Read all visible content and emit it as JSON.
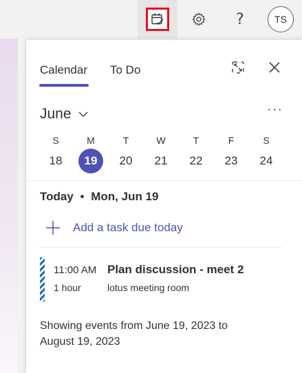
{
  "topbar": {
    "my_day_icon": "calendar-check-icon",
    "settings_icon": "gear-icon",
    "help_label": "?",
    "avatar_initials": "TS"
  },
  "panel": {
    "tabs": [
      {
        "label": "Calendar",
        "active": true
      },
      {
        "label": "To Do",
        "active": false
      }
    ],
    "expand_icon": "expand-icon",
    "close_icon": "close-icon"
  },
  "calendar": {
    "month": "June",
    "more_label": "···",
    "weekdays": [
      "S",
      "M",
      "T",
      "W",
      "T",
      "F",
      "S"
    ],
    "days": [
      "18",
      "19",
      "20",
      "21",
      "22",
      "23",
      "24"
    ],
    "selected_day": "19"
  },
  "agenda": {
    "today_prefix": "Today",
    "bullet": "•",
    "today_date": "Mon, Jun 19",
    "add_task_label": "Add a task due today",
    "event": {
      "time": "11:00 AM",
      "duration": "1 hour",
      "title": "Plan discussion - meet 2",
      "location": "lotus meeting room"
    },
    "footer": "Showing events from June 19, 2023 to August 19, 2023"
  },
  "colors": {
    "accent": "#4f52b2",
    "highlight_border": "#e81123",
    "event_bar": "#1f6fc5"
  }
}
